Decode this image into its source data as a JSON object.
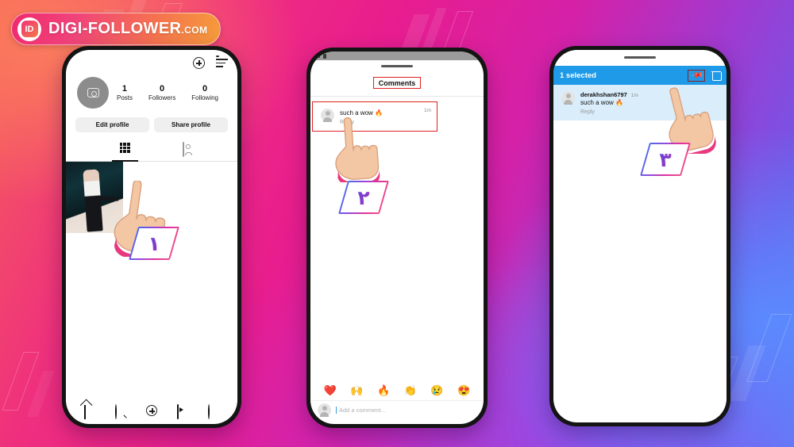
{
  "brand": {
    "logo_text": "DIGI-FOLLOWER",
    "logo_suffix": ".COM",
    "logo_mark": "ID"
  },
  "phone1": {
    "name": "instagram-profile-screen",
    "topbar": {
      "add_icon": "plus-circle-icon",
      "menu_icon": "hamburger-menu-icon"
    },
    "avatar_icon": "camera-avatar-icon",
    "stats": [
      {
        "value": "1",
        "label": "Posts"
      },
      {
        "value": "0",
        "label": "Followers"
      },
      {
        "value": "0",
        "label": "Following"
      }
    ],
    "buttons": [
      {
        "label": "Edit profile"
      },
      {
        "label": "Share profile"
      }
    ],
    "tabs": [
      {
        "icon": "grid-icon",
        "active": true
      },
      {
        "icon": "tagged-icon",
        "active": false
      }
    ],
    "nav": [
      {
        "icon": "home-icon"
      },
      {
        "icon": "search-icon"
      },
      {
        "icon": "add-post-icon"
      },
      {
        "icon": "reels-icon"
      },
      {
        "icon": "profile-icon"
      }
    ]
  },
  "phone2": {
    "name": "comments-screen",
    "status_icons": [
      "notification-icon",
      "sim-icon"
    ],
    "title": "Comments",
    "comment": {
      "time": "1m",
      "text": "such a wow 🔥",
      "reply_label": "Reply",
      "avatar_icon": "user-avatar-icon"
    },
    "emoji_bar": [
      "❤️",
      "🙌",
      "🔥",
      "👏",
      "😢",
      "😍"
    ],
    "input_placeholder": "Add a comment…"
  },
  "phone3": {
    "name": "comment-selected-screen",
    "selection_label": "1 selected",
    "actions": [
      {
        "icon": "pin-icon",
        "highlighted": true
      },
      {
        "icon": "trash-icon",
        "highlighted": false
      }
    ],
    "comment": {
      "username": "derakhshan6797",
      "time": "1m",
      "text": "such a wow 🔥",
      "reply_label": "Reply",
      "avatar_icon": "user-avatar-icon"
    }
  },
  "steps": [
    {
      "numeral": "۱",
      "name": "step-1-badge"
    },
    {
      "numeral": "۲",
      "name": "step-2-badge"
    },
    {
      "numeral": "۳",
      "name": "step-3-badge"
    }
  ],
  "colors": {
    "selection_bar": "#1e9ae8",
    "selected_row": "#d9edfb",
    "highlight_outline": "#e02020",
    "brand_pink": "#ef2a6e",
    "brand_orange": "#f59b3a"
  }
}
